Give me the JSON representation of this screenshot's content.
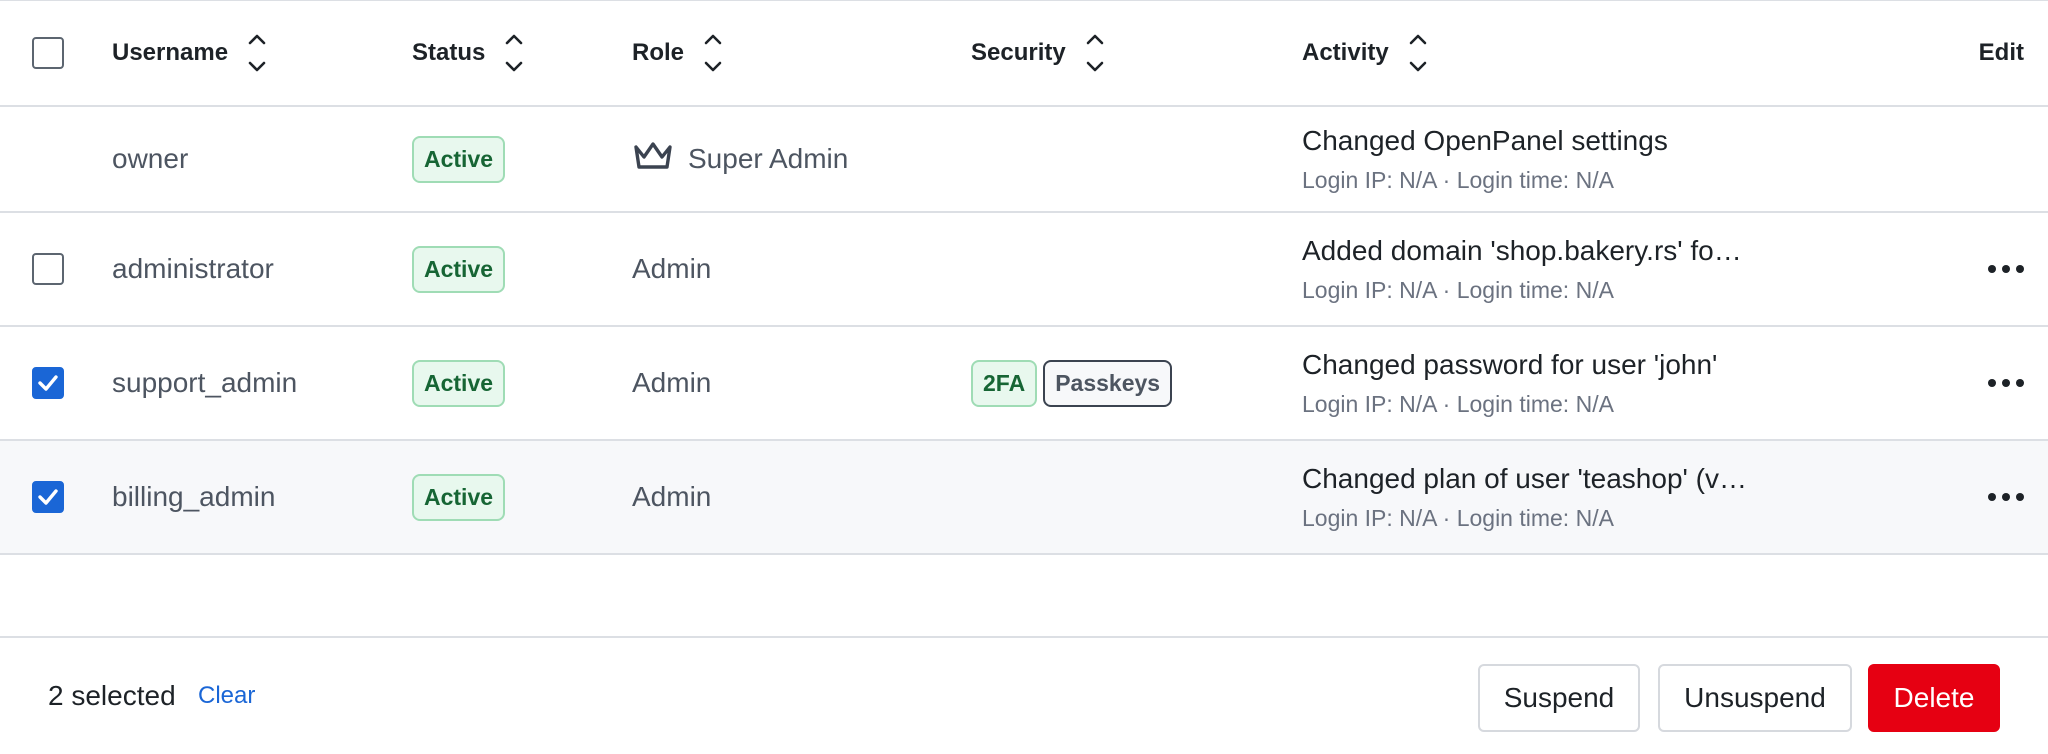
{
  "columns": {
    "username": "Username",
    "status": "Status",
    "role": "Role",
    "security": "Security",
    "activity": "Activity",
    "edit": "Edit"
  },
  "rows": [
    {
      "checkbox": "none",
      "username": "owner",
      "status": "Active",
      "role": "Super Admin",
      "role_icon": "crown-icon",
      "security": [],
      "activity_title": "Changed OpenPanel settings",
      "activity_sub": "Login IP: N/A · Login time: N/A",
      "has_menu": false
    },
    {
      "checkbox": "unchecked",
      "username": "administrator",
      "status": "Active",
      "role": "Admin",
      "security": [],
      "activity_title": "Added domain 'shop.bakery.rs' fo…",
      "activity_sub": "Login IP: N/A · Login time: N/A",
      "has_menu": true
    },
    {
      "checkbox": "checked",
      "username": "support_admin",
      "status": "Active",
      "role": "Admin",
      "security": [
        "2FA",
        "Passkeys"
      ],
      "activity_title": "Changed password for user 'john'",
      "activity_sub": "Login IP: N/A · Login time: N/A",
      "has_menu": true
    },
    {
      "checkbox": "checked",
      "username": "billing_admin",
      "status": "Active",
      "role": "Admin",
      "security": [],
      "activity_title": "Changed plan of user 'teashop' (v…",
      "activity_sub": "Login IP: N/A · Login time: N/A",
      "has_menu": true
    }
  ],
  "footer": {
    "selected_text": "2 selected",
    "clear_label": "Clear",
    "suspend_label": "Suspend",
    "unsuspend_label": "Unsuspend",
    "delete_label": "Delete"
  },
  "colors": {
    "accent": "#1a66d6",
    "danger": "#e60012",
    "active_badge_bg": "#e8f8ee",
    "active_badge_text": "#166534"
  }
}
